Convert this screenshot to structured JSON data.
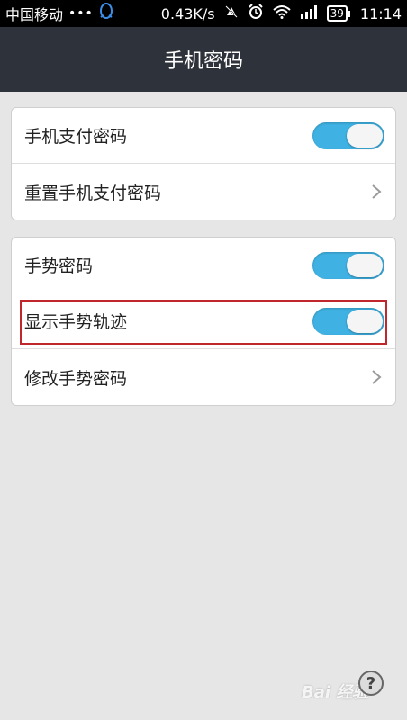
{
  "status_bar": {
    "carrier": "中国移动",
    "dots": "•••",
    "qq_icon": "qq-penguin-icon",
    "speed": "0.43K/s",
    "battery": "39",
    "time": "11:14"
  },
  "header": {
    "title": "手机密码"
  },
  "settings": {
    "group1": [
      {
        "label": "手机支付密码",
        "control": "toggle",
        "on": true
      },
      {
        "label": "重置手机支付密码",
        "control": "chevron"
      }
    ],
    "group2": [
      {
        "label": "手势密码",
        "control": "toggle",
        "on": true
      },
      {
        "label": "显示手势轨迹",
        "control": "toggle",
        "on": true
      },
      {
        "label": "修改手势密码",
        "control": "chevron"
      }
    ]
  },
  "colors": {
    "toggle_on": "#3fb1e2",
    "header_bg": "#2e323a",
    "highlight": "#c0272d"
  },
  "footer": {
    "help_label": "?",
    "watermark": "Bai 经验"
  }
}
